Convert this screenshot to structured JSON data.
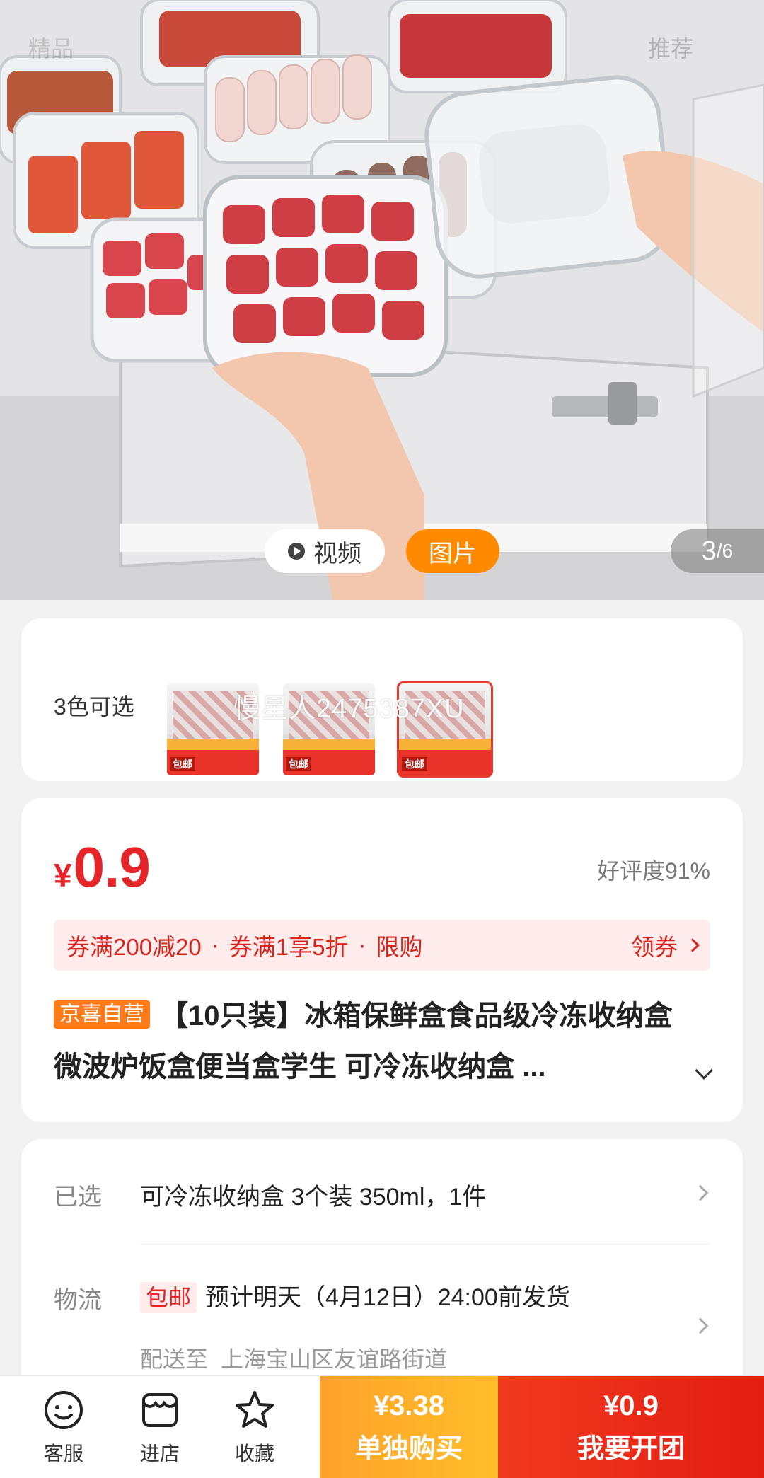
{
  "hero": {
    "tab_left": "精品",
    "tab_right": "推荐",
    "video_label": "视频",
    "image_label": "图片",
    "page_current": "3",
    "page_total": "/6"
  },
  "colors": {
    "label": "3色可选",
    "watermark": "慢星人2475387XU",
    "thumbs": [
      {
        "badge": "包邮",
        "selected": false
      },
      {
        "badge": "包邮",
        "selected": false
      },
      {
        "badge": "包邮",
        "selected": true
      }
    ]
  },
  "price": {
    "symbol": "¥",
    "value": "0.9",
    "rating": "好评度91%"
  },
  "coupon": {
    "item1": "券满200减20",
    "item2": "券满1享5折",
    "item3": "限购",
    "separator": "·",
    "claim": "领券"
  },
  "product": {
    "tag": "京喜自营",
    "title": "【10只装】冰箱保鲜盒食品级冷冻收纳盒微波炉饭盒便当盒学生 可冷冻收纳盒 ..."
  },
  "spec": {
    "selected_label": "已选",
    "selected_value": "可冷冻收纳盒 3个装 350ml，1件",
    "shipping_label": "物流",
    "free_shipping": "包邮",
    "shipping_value": "预计明天（4月12日）24:00前发货",
    "deliver_to_label": "配送至",
    "deliver_to_addr": "上海宝山区友谊路街道"
  },
  "bottom": {
    "service": "客服",
    "store": "进店",
    "favorite": "收藏",
    "solo_price": "¥3.38",
    "solo_label": "单独购买",
    "group_price": "¥0.9",
    "group_label": "我要开团"
  },
  "theme": {
    "accent_red": "#e4252a",
    "accent_orange": "#ff8a00"
  }
}
